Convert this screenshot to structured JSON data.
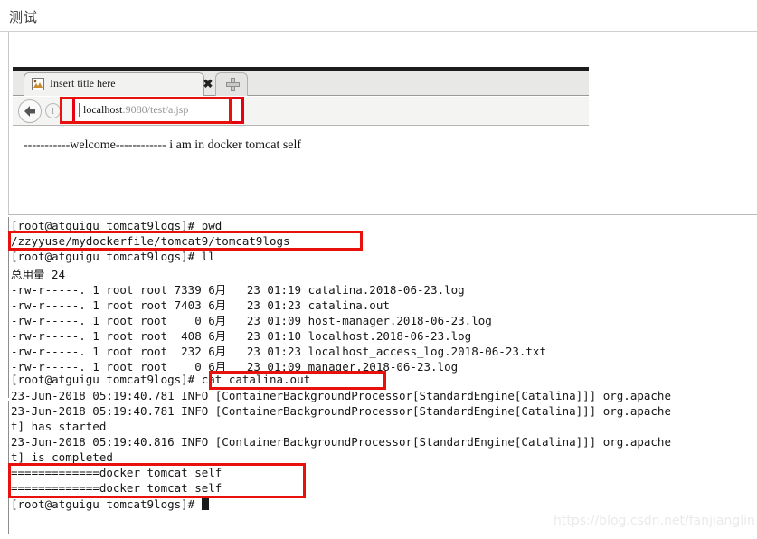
{
  "page": {
    "header_title": "测试",
    "watermark": "https://blog.csdn.net/fanjianglin"
  },
  "browser": {
    "tab": {
      "favicon": "image-icon",
      "title": "Insert title here",
      "close_label": "✖"
    },
    "new_tab_label": "+",
    "back_icon": "back-arrow-icon",
    "site_info_icon": "info-icon",
    "url": {
      "host": "localhost",
      "rest": ":9080/test/a.jsp",
      "full": "localhost:9080/test/a.jsp"
    },
    "viewport": {
      "content": "-----------welcome------------ i am in docker tomcat self"
    }
  },
  "terminal": {
    "lines": [
      "[root@atguigu tomcat9logs]# pwd",
      "/zzyyuse/mydockerfile/tomcat9/tomcat9logs",
      "[root@atguigu tomcat9logs]# ll",
      "总用量 24",
      "-rw-r-----. 1 root root 7339 6月   23 01:19 catalina.2018-06-23.log",
      "-rw-r-----. 1 root root 7403 6月   23 01:23 catalina.out",
      "-rw-r-----. 1 root root    0 6月   23 01:09 host-manager.2018-06-23.log",
      "-rw-r-----. 1 root root  408 6月   23 01:10 localhost.2018-06-23.log",
      "-rw-r-----. 1 root root  232 6月   23 01:23 localhost_access_log.2018-06-23.txt",
      "-rw-r-----. 1 root root    0 6月   23 01:09 manager.2018-06-23.log",
      "[root@atguigu tomcat9logs]# cat catalina.out",
      "23-Jun-2018 05:19:40.781 INFO [ContainerBackgroundProcessor[StandardEngine[Catalina]]] org.apache",
      "23-Jun-2018 05:19:40.781 INFO [ContainerBackgroundProcessor[StandardEngine[Catalina]]] org.apache",
      "t] has started",
      "23-Jun-2018 05:19:40.816 INFO [ContainerBackgroundProcessor[StandardEngine[Catalina]]] org.apache",
      "t] is completed",
      "=============docker tomcat self",
      "=============docker tomcat self",
      "[root@atguigu tomcat9logs]# "
    ],
    "prompt": "[root@atguigu tomcat9logs]# ",
    "cursor": "block-cursor"
  },
  "annotations": {
    "color": "#e8110c",
    "boxes": [
      {
        "name": "url-highlight",
        "label": "localhost:9080/test/a.jsp"
      },
      {
        "name": "pwd-output-highlight",
        "label": "/zzyyuse/mydockerfile/tomcat9/tomcat9logs"
      },
      {
        "name": "cat-command-highlight",
        "label": "cat catalina.out"
      },
      {
        "name": "docker-tomcat-self-highlight",
        "label": "=============docker tomcat self"
      }
    ]
  }
}
